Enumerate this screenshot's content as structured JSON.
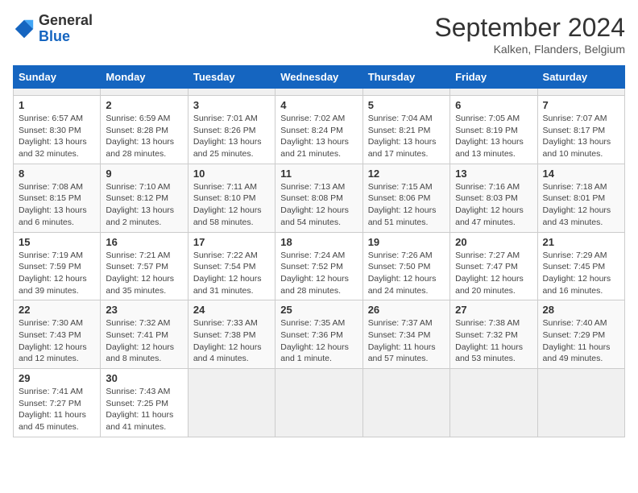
{
  "header": {
    "logo_general": "General",
    "logo_blue": "Blue",
    "month_title": "September 2024",
    "location": "Kalken, Flanders, Belgium"
  },
  "calendar": {
    "days_of_week": [
      "Sunday",
      "Monday",
      "Tuesday",
      "Wednesday",
      "Thursday",
      "Friday",
      "Saturday"
    ],
    "weeks": [
      [
        {
          "day": "",
          "empty": true
        },
        {
          "day": "",
          "empty": true
        },
        {
          "day": "",
          "empty": true
        },
        {
          "day": "",
          "empty": true
        },
        {
          "day": "",
          "empty": true
        },
        {
          "day": "",
          "empty": true
        },
        {
          "day": "",
          "empty": true
        }
      ],
      [
        {
          "day": "1",
          "sunrise": "6:57 AM",
          "sunset": "8:30 PM",
          "daylight": "13 hours and 32 minutes."
        },
        {
          "day": "2",
          "sunrise": "6:59 AM",
          "sunset": "8:28 PM",
          "daylight": "13 hours and 28 minutes."
        },
        {
          "day": "3",
          "sunrise": "7:01 AM",
          "sunset": "8:26 PM",
          "daylight": "13 hours and 25 minutes."
        },
        {
          "day": "4",
          "sunrise": "7:02 AM",
          "sunset": "8:24 PM",
          "daylight": "13 hours and 21 minutes."
        },
        {
          "day": "5",
          "sunrise": "7:04 AM",
          "sunset": "8:21 PM",
          "daylight": "13 hours and 17 minutes."
        },
        {
          "day": "6",
          "sunrise": "7:05 AM",
          "sunset": "8:19 PM",
          "daylight": "13 hours and 13 minutes."
        },
        {
          "day": "7",
          "sunrise": "7:07 AM",
          "sunset": "8:17 PM",
          "daylight": "13 hours and 10 minutes."
        }
      ],
      [
        {
          "day": "8",
          "sunrise": "7:08 AM",
          "sunset": "8:15 PM",
          "daylight": "13 hours and 6 minutes."
        },
        {
          "day": "9",
          "sunrise": "7:10 AM",
          "sunset": "8:12 PM",
          "daylight": "13 hours and 2 minutes."
        },
        {
          "day": "10",
          "sunrise": "7:11 AM",
          "sunset": "8:10 PM",
          "daylight": "12 hours and 58 minutes."
        },
        {
          "day": "11",
          "sunrise": "7:13 AM",
          "sunset": "8:08 PM",
          "daylight": "12 hours and 54 minutes."
        },
        {
          "day": "12",
          "sunrise": "7:15 AM",
          "sunset": "8:06 PM",
          "daylight": "12 hours and 51 minutes."
        },
        {
          "day": "13",
          "sunrise": "7:16 AM",
          "sunset": "8:03 PM",
          "daylight": "12 hours and 47 minutes."
        },
        {
          "day": "14",
          "sunrise": "7:18 AM",
          "sunset": "8:01 PM",
          "daylight": "12 hours and 43 minutes."
        }
      ],
      [
        {
          "day": "15",
          "sunrise": "7:19 AM",
          "sunset": "7:59 PM",
          "daylight": "12 hours and 39 minutes."
        },
        {
          "day": "16",
          "sunrise": "7:21 AM",
          "sunset": "7:57 PM",
          "daylight": "12 hours and 35 minutes."
        },
        {
          "day": "17",
          "sunrise": "7:22 AM",
          "sunset": "7:54 PM",
          "daylight": "12 hours and 31 minutes."
        },
        {
          "day": "18",
          "sunrise": "7:24 AM",
          "sunset": "7:52 PM",
          "daylight": "12 hours and 28 minutes."
        },
        {
          "day": "19",
          "sunrise": "7:26 AM",
          "sunset": "7:50 PM",
          "daylight": "12 hours and 24 minutes."
        },
        {
          "day": "20",
          "sunrise": "7:27 AM",
          "sunset": "7:47 PM",
          "daylight": "12 hours and 20 minutes."
        },
        {
          "day": "21",
          "sunrise": "7:29 AM",
          "sunset": "7:45 PM",
          "daylight": "12 hours and 16 minutes."
        }
      ],
      [
        {
          "day": "22",
          "sunrise": "7:30 AM",
          "sunset": "7:43 PM",
          "daylight": "12 hours and 12 minutes."
        },
        {
          "day": "23",
          "sunrise": "7:32 AM",
          "sunset": "7:41 PM",
          "daylight": "12 hours and 8 minutes."
        },
        {
          "day": "24",
          "sunrise": "7:33 AM",
          "sunset": "7:38 PM",
          "daylight": "12 hours and 4 minutes."
        },
        {
          "day": "25",
          "sunrise": "7:35 AM",
          "sunset": "7:36 PM",
          "daylight": "12 hours and 1 minute."
        },
        {
          "day": "26",
          "sunrise": "7:37 AM",
          "sunset": "7:34 PM",
          "daylight": "11 hours and 57 minutes."
        },
        {
          "day": "27",
          "sunrise": "7:38 AM",
          "sunset": "7:32 PM",
          "daylight": "11 hours and 53 minutes."
        },
        {
          "day": "28",
          "sunrise": "7:40 AM",
          "sunset": "7:29 PM",
          "daylight": "11 hours and 49 minutes."
        }
      ],
      [
        {
          "day": "29",
          "sunrise": "7:41 AM",
          "sunset": "7:27 PM",
          "daylight": "11 hours and 45 minutes."
        },
        {
          "day": "30",
          "sunrise": "7:43 AM",
          "sunset": "7:25 PM",
          "daylight": "11 hours and 41 minutes."
        },
        {
          "day": "",
          "empty": true
        },
        {
          "day": "",
          "empty": true
        },
        {
          "day": "",
          "empty": true
        },
        {
          "day": "",
          "empty": true
        },
        {
          "day": "",
          "empty": true
        }
      ]
    ],
    "labels": {
      "sunrise": "Sunrise:",
      "sunset": "Sunset:",
      "daylight": "Daylight:"
    }
  }
}
